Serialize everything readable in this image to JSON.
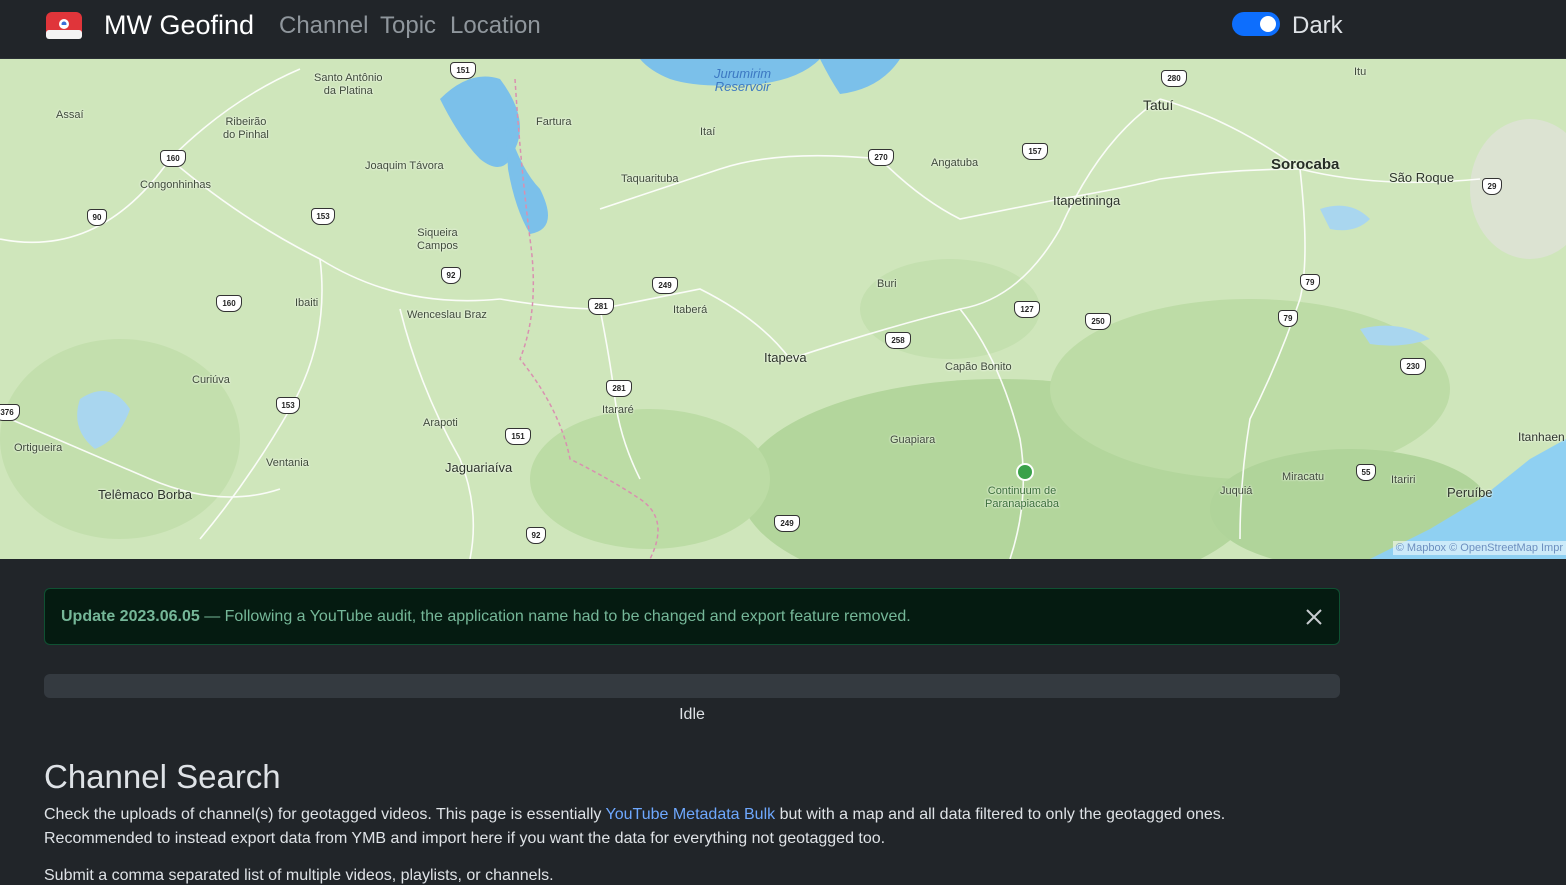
{
  "navbar": {
    "brand": "MW Geofind",
    "links": [
      "Channel",
      "Topic",
      "Location"
    ],
    "theme_toggle_label": "Dark",
    "theme_toggle_on": true
  },
  "map": {
    "labels": [
      {
        "text": "Santo Antônio\nda Platina",
        "kind": "town"
      },
      {
        "text": "Assaí",
        "kind": "town"
      },
      {
        "text": "Ribeirão\ndo Pinhal",
        "kind": "town"
      },
      {
        "text": "Joaquim Távora",
        "kind": "town"
      },
      {
        "text": "Fartura",
        "kind": "town"
      },
      {
        "text": "Itaí",
        "kind": "town"
      },
      {
        "text": "Jurumirim\nReservoir",
        "kind": "water"
      },
      {
        "text": "Tatuí",
        "kind": "city"
      },
      {
        "text": "Itu",
        "kind": "town"
      },
      {
        "text": "Sorocaba",
        "kind": "big"
      },
      {
        "text": "São Roque",
        "kind": "city"
      },
      {
        "text": "Congonhinhas",
        "kind": "town"
      },
      {
        "text": "Taquarituba",
        "kind": "town"
      },
      {
        "text": "Angatuba",
        "kind": "town"
      },
      {
        "text": "Itapetininga",
        "kind": "city"
      },
      {
        "text": "Siqueira\nCampos",
        "kind": "town"
      },
      {
        "text": "Buri",
        "kind": "town"
      },
      {
        "text": "Ibaiti",
        "kind": "town"
      },
      {
        "text": "Wenceslau Braz",
        "kind": "town"
      },
      {
        "text": "Itaberá",
        "kind": "town"
      },
      {
        "text": "Itapeva",
        "kind": "city"
      },
      {
        "text": "Capão Bonito",
        "kind": "town"
      },
      {
        "text": "Curiúva",
        "kind": "town"
      },
      {
        "text": "Itararé",
        "kind": "town"
      },
      {
        "text": "Arapoti",
        "kind": "town"
      },
      {
        "text": "Guapiara",
        "kind": "town"
      },
      {
        "text": "Ortigueira",
        "kind": "town"
      },
      {
        "text": "Ventania",
        "kind": "town"
      },
      {
        "text": "Jaguariaíva",
        "kind": "city"
      },
      {
        "text": "Telêmaco Borba",
        "kind": "city"
      },
      {
        "text": "Continuum de\nParanapiacaba",
        "kind": "town"
      },
      {
        "text": "Juquiá",
        "kind": "town"
      },
      {
        "text": "Miracatu",
        "kind": "town"
      },
      {
        "text": "Itariri",
        "kind": "town"
      },
      {
        "text": "Peruíbe",
        "kind": "city"
      },
      {
        "text": "Itanhaen",
        "kind": "city"
      }
    ],
    "shields": [
      "151",
      "280",
      "160",
      "270",
      "157",
      "90",
      "153",
      "29",
      "92",
      "249",
      "281",
      "79",
      "160",
      "127",
      "250",
      "79",
      "258",
      "230",
      "281",
      "376",
      "153",
      "151",
      "55",
      "92",
      "249"
    ],
    "attribution": "© Mapbox © OpenStreetMap  Impr"
  },
  "alert": {
    "title": "Update 2023.06.05",
    "message": " — Following a YouTube audit, the application name had to be changed and export feature removed."
  },
  "progress": {
    "value": 0,
    "label": "Idle"
  },
  "content": {
    "heading": "Channel Search",
    "desc_before": "Check the uploads of channel(s) for geotagged videos. This page is essentially ",
    "desc_link": "YouTube Metadata Bulk",
    "desc_after": " but with a map and all data filtered to only the geotagged ones. Recommended to instead export data from YMB and import here if you want the data for everything not geotagged too.",
    "submit_note": "Submit a comma separated list of multiple videos, playlists, or channels."
  }
}
